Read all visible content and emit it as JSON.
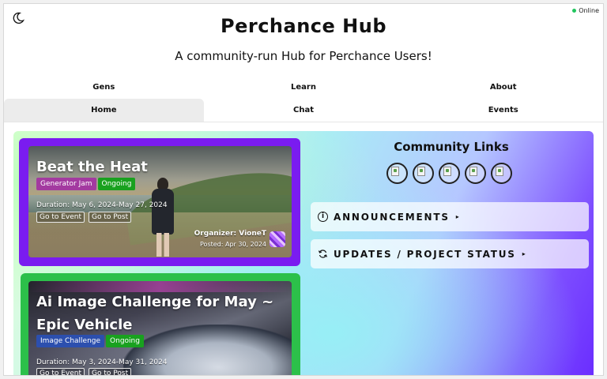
{
  "status": {
    "label": "Online",
    "color": "#22c55e"
  },
  "header": {
    "theme_icon": "moon-icon",
    "title": "Perchance Hub",
    "subtitle": "A community-run Hub for Perchance Users!"
  },
  "nav": {
    "row1": [
      "Gens",
      "Learn",
      "About"
    ],
    "row2": [
      "Home",
      "Chat",
      "Events"
    ],
    "active": "Home"
  },
  "events": [
    {
      "title": "Beat the Heat",
      "tags": [
        "Generator Jam",
        "Ongoing"
      ],
      "duration": "Duration: May 6, 2024-May 27, 2024",
      "buttons": [
        "Go to Event",
        "Go to Post"
      ],
      "organizer": "Organizer: VioneT",
      "posted": "Posted: Apr 30, 2024",
      "border_color": "#7a1cf0"
    },
    {
      "title": "Ai Image Challenge for May ~ Epic Vehicle",
      "tags": [
        "Image Challenge",
        "Ongoing"
      ],
      "duration": "Duration: May 3, 2024-May 31, 2024",
      "buttons": [
        "Go to Event",
        "Go to Post"
      ],
      "border_color": "#2cc04a"
    }
  ],
  "community": {
    "title": "Community Links",
    "link_icons": [
      "broken-image-icon",
      "broken-image-icon",
      "broken-image-icon",
      "broken-image-icon",
      "broken-image-icon"
    ]
  },
  "panels": {
    "announcements": {
      "label": "ANNOUNCEMENTS",
      "icon": "info-icon",
      "arrow": "▸"
    },
    "updates": {
      "label": "UPDATES / PROJECT STATUS",
      "icon": "refresh-icon",
      "arrow": "▸"
    }
  }
}
